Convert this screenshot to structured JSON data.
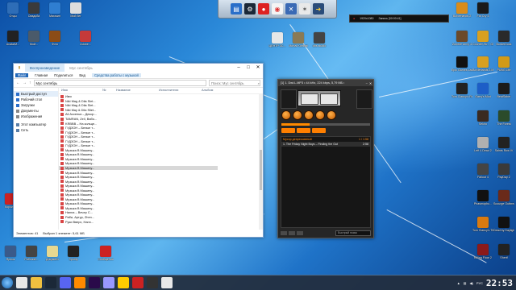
{
  "dock": {
    "icons": [
      "folder-icon",
      "steam-icon",
      "record-icon",
      "chrome-icon",
      "tools-icon",
      "star-icon",
      "arrow-icon"
    ]
  },
  "recorder": {
    "resolution": "1920x1080",
    "label": "Запись [00:00:41]"
  },
  "desktop_left": [
    {
      "name": "lol",
      "label": "Отцы",
      "color": "#2e6db7"
    },
    {
      "name": "grave",
      "label": "Свадьба",
      "color": "#3a3a3a"
    },
    {
      "name": "shop",
      "label": "Магазин",
      "color": "#2f7ed1"
    },
    {
      "name": "user",
      "label": "Мой бег",
      "color": "#ddd"
    },
    {
      "name": "photo",
      "label": "Фото",
      "color": "#8b4c16"
    },
    {
      "name": "avatar",
      "label": "AvatarM...",
      "color": "#222"
    },
    {
      "name": "gear",
      "label": "Мой...",
      "color": "#4a5a6a"
    },
    {
      "name": "app2",
      "label": "Adobe...",
      "color": "#c53a3a"
    },
    {
      "name": "recycle",
      "label": "Корзина",
      "color": "#8fb7dc"
    }
  ],
  "desktop_top": [
    {
      "label": "ЦЕНТР ЗС...",
      "color": "#e7e7e7"
    },
    {
      "label": "Mortal Kombat",
      "color": "#8a7a55"
    },
    {
      "label": "obs studio",
      "color": "#444"
    }
  ],
  "desktop_right": [
    {
      "label": "Borderlands 2",
      "color": "#d98c1a"
    },
    {
      "label": "Far Cry 5",
      "color": "#1a1a1a"
    },
    {
      "label": "Zombie Army 4",
      "color": "#6b4a2a"
    },
    {
      "label": "Counter-Str... Global Offe...",
      "color": "#d8a020"
    },
    {
      "label": "BorderDock",
      "color": "#2a2a2a"
    },
    {
      "label": "Epic Games Launcher",
      "color": "#111"
    },
    {
      "label": "Borderlands 3 Multiplayer",
      "color": "#d9a020"
    },
    {
      "label": "PUBG Lite",
      "color": "#d19a18"
    },
    {
      "label": "Tom Clancy's Rainbow Si...",
      "color": "#222"
    },
    {
      "label": "Garry's Mod",
      "color": "#1d5ec7"
    },
    {
      "label": "BeatSaber",
      "color": "#1b1b1b"
    },
    {
      "label": "Sekiro",
      "color": "#3a2a20"
    },
    {
      "label": "The Forest",
      "color": "#2b4b2b"
    },
    {
      "label": "Left 4 Dead 2",
      "color": "#b0b0b0"
    },
    {
      "label": "Saints Row IV",
      "color": "#222"
    },
    {
      "label": "Fallout 4",
      "color": "#444"
    },
    {
      "label": "PayDay 2",
      "color": "#3a3a3a"
    },
    {
      "label": "Phasmopho...",
      "color": "#111"
    },
    {
      "label": "Scourge Outbreak",
      "color": "#6a2a1a"
    },
    {
      "label": "Tom Clancy's The Divi...",
      "color": "#d97a10"
    },
    {
      "label": "Dead by Daylight",
      "color": "#111"
    },
    {
      "label": "Killing Floor 2",
      "color": "#8b1a1a"
    },
    {
      "label": "Sherif",
      "color": "#222"
    }
  ],
  "desktop_bottom": [
    {
      "label": "Ярлык",
      "color": "#3a5a8a"
    },
    {
      "label": "Рабочий...",
      "color": "#444"
    },
    {
      "label": "Документ",
      "color": "#e8d890"
    },
    {
      "label": "Spotify",
      "color": "#222"
    },
    {
      "label": "Сообщения",
      "color": "#c22"
    }
  ],
  "explorer": {
    "tab_active": "Воспроизведение",
    "tab_path": "Мус сентябрь",
    "ribbon": [
      "Файл",
      "Главная",
      "Поделиться",
      "Вид",
      "Средства работы с музыкой"
    ],
    "ribbon_active_index": 4,
    "address": "Мус сентябрь",
    "search_placeholder": "Поиск: Мус сентябрь",
    "nav": [
      {
        "label": "Быстрый доступ",
        "color": "#2b6ec9"
      },
      {
        "label": "Рабочий стол",
        "color": "#2b6ec9"
      },
      {
        "label": "Загрузки",
        "color": "#2b6ec9"
      },
      {
        "label": "Документы",
        "color": "#888"
      },
      {
        "label": "Изображения",
        "color": "#888"
      },
      {
        "label": "Этот компьютер",
        "color": "#5a7fa8"
      },
      {
        "label": "Сеть",
        "color": "#5a7fa8"
      }
    ],
    "columns": [
      "Имя",
      "№",
      "Название",
      "Исполнители",
      "Альбом"
    ],
    "files": [
      "Имя",
      "Niki Mag & Dila Slet...",
      "Niki Mag & Dila Slet...",
      "Niki May & Dila Sliet...",
      "Ali Асселья – Декор...",
      "TAMRAN, Zell, Bабо...",
      "KRBBB – На кольце...",
      "ГУДЗОН – Белые т...",
      "ГУДЗОН – Белые т...",
      "ГУДЗОН – Белые т...",
      "ГУДЗОН – Белые т...",
      "ГУДЗОН – Белые т...",
      "Музыка В Машину...",
      "Музыка В Машину...",
      "Музыка В Машину...",
      "Музыка В Машину...",
      "Музыка В Машину...",
      "Музыка В Машину...",
      "Музыка В Машину...",
      "Музыка В Машину...",
      "Музыка В Машину...",
      "Музыка В Машину...",
      "Музыка В Машину...",
      "Музыка В Машину...",
      "Музыка В Машину...",
      "Музыка В Машину...",
      "Hanna – Вечер С...",
      "Раби, Артур, Zhen...",
      "Руки Вверх, Hann..."
    ],
    "selected_index": 16,
    "status_count": "Элементов: 41",
    "status_selected": "Выбран 1 элемент: 5,61 МБ"
  },
  "player": {
    "title": "[1] 1. Dwt.L.MP3 • 44 kHz, 224 kbps, 5,79 МБ •",
    "group_label": "Мусор депрессивный",
    "group_count": "1 / 1:58",
    "track_label": "1. The Friday Night Boys – Finding the Gut",
    "track_time": "2:58",
    "search_placeholder": "Быстрый поиск"
  },
  "taskbar": {
    "icons": [
      {
        "name": "chrome-taskbar-icon",
        "color": "#e8e8e8"
      },
      {
        "name": "explorer-taskbar-icon",
        "color": "#f0c040"
      },
      {
        "name": "steam-taskbar-icon",
        "color": "#1b2838"
      },
      {
        "name": "discord-taskbar-icon",
        "color": "#5865f2"
      },
      {
        "name": "media-taskbar-icon",
        "color": "#ff8a00"
      },
      {
        "name": "adobe-taskbar-icon",
        "color": "#2a0a4a"
      },
      {
        "name": "premiere-taskbar-icon",
        "color": "#9999ff"
      },
      {
        "name": "yandex-taskbar-icon",
        "color": "#ffcc00"
      },
      {
        "name": "app-taskbar-icon",
        "color": "#c22"
      },
      {
        "name": "game-taskbar-icon",
        "color": "#333"
      },
      {
        "name": "music-taskbar-icon",
        "color": "#e8e8e8"
      }
    ],
    "lang": "РУС",
    "clock": "22:53"
  }
}
